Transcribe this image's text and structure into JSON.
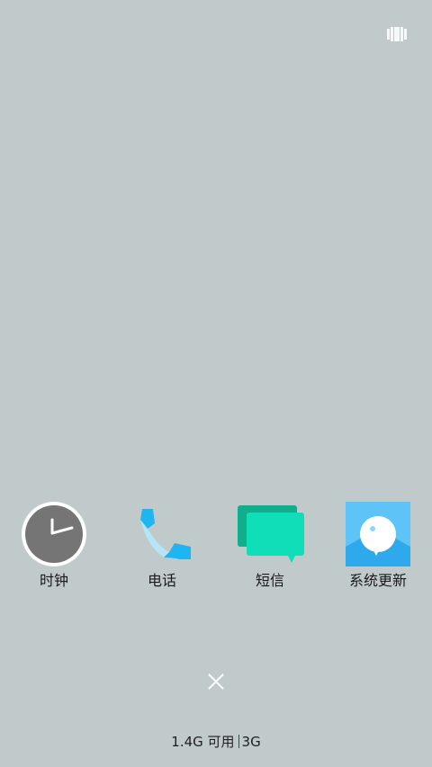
{
  "top_right_icon": "recent-apps-icon",
  "apps": [
    {
      "label": "时钟",
      "icon": "clock-icon"
    },
    {
      "label": "电话",
      "icon": "phone-icon"
    },
    {
      "label": "短信",
      "icon": "sms-icon"
    },
    {
      "label": "系统更新",
      "icon": "system-update-icon"
    }
  ],
  "close_icon": "close-icon",
  "memory_status": {
    "memory_text": "1.4G 可用",
    "total_text": "3G"
  },
  "colors": {
    "background": "#c1cacb",
    "clock_face": "#757575",
    "phone_blue": "#1fb5f0",
    "sms_green": "#0fdeb8",
    "update_blue": "#5ec4f8"
  }
}
